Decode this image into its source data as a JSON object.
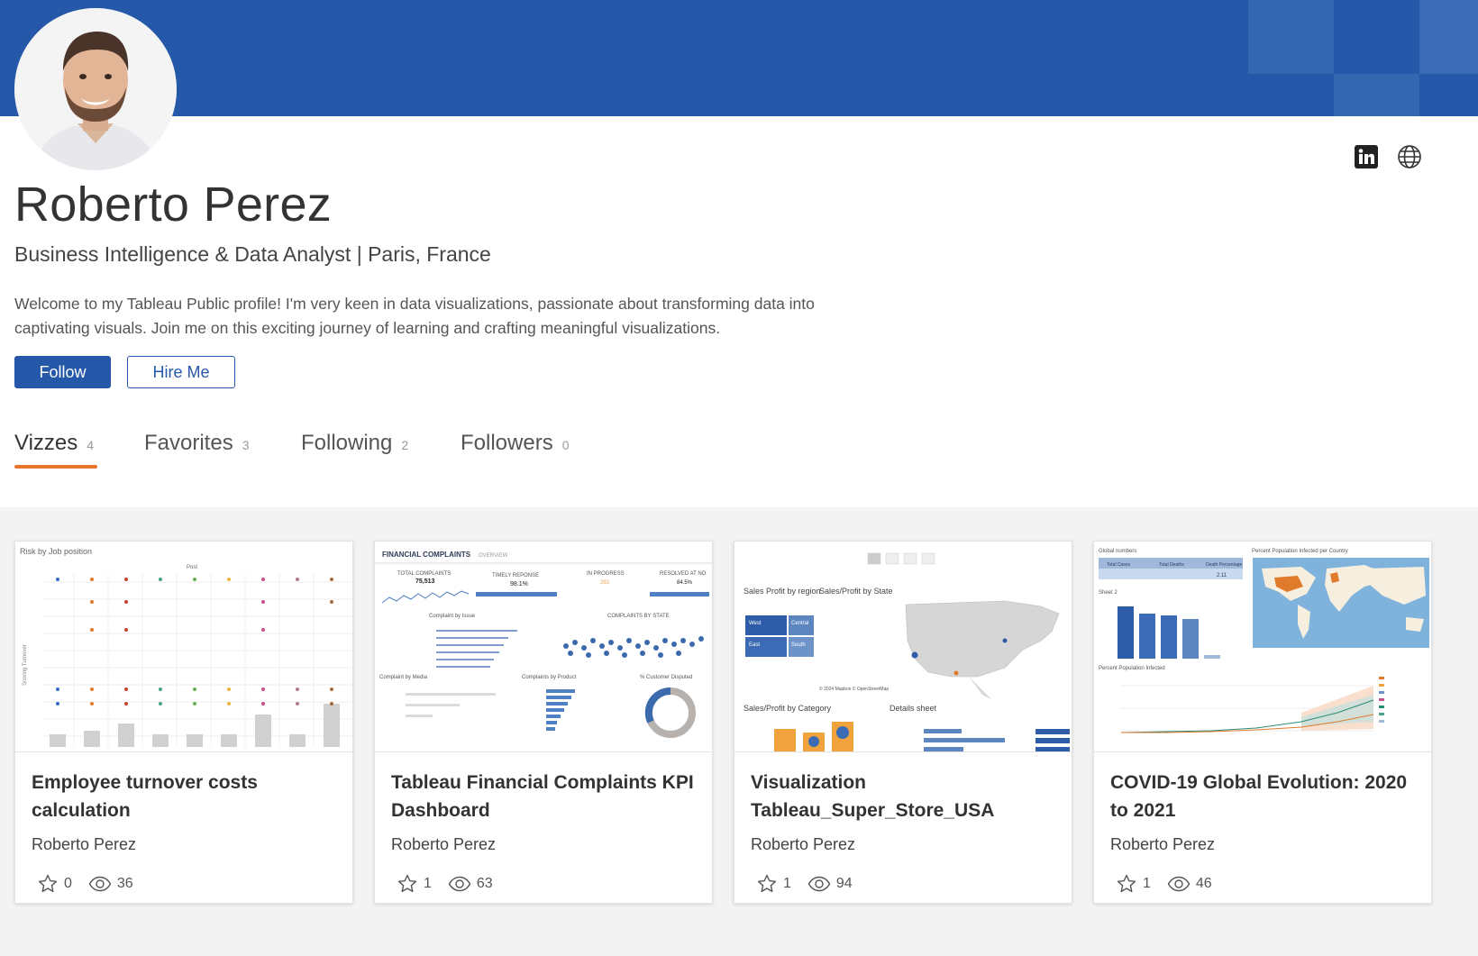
{
  "profile": {
    "name": "Roberto Perez",
    "headline": "Business Intelligence & Data Analyst | Paris, France",
    "bio": "Welcome to my Tableau Public profile! I'm very keen in data visualizations, passionate about transforming data into captivating visuals. Join me on this exciting journey of learning and crafting meaningful visualizations."
  },
  "buttons": {
    "follow": "Follow",
    "hire": "Hire Me"
  },
  "social": {
    "linkedin_icon": "linkedin-icon",
    "website_icon": "globe-icon"
  },
  "tabs": [
    {
      "label": "Vizzes",
      "count": "4"
    },
    {
      "label": "Favorites",
      "count": "3"
    },
    {
      "label": "Following",
      "count": "2"
    },
    {
      "label": "Followers",
      "count": "0"
    }
  ],
  "vizzes": [
    {
      "title": "Employee turnover costs calculation",
      "author": "Roberto Perez",
      "favorites": "0",
      "views": "36"
    },
    {
      "title": "Tableau Financial Complaints KPI Dashboard",
      "author": "Roberto Perez",
      "favorites": "1",
      "views": "63"
    },
    {
      "title": "Visualization Tableau_Super_Store_USA",
      "author": "Roberto Perez",
      "favorites": "1",
      "views": "94"
    },
    {
      "title": "COVID-19 Global Evolution: 2020 to 2021",
      "author": "Roberto Perez",
      "favorites": "1",
      "views": "46"
    }
  ],
  "thumbs": {
    "t1": {
      "title": "Risk by Job position",
      "header": "Post",
      "yaxis": "Scoring Turnover"
    },
    "t2": {
      "title": "FINANCIAL COMPLAINTS",
      "sub": "OVERVIEW",
      "k1": "TOTAL COMPLAINTS",
      "v1": "75,513",
      "k2": "TIMELY REPONSE",
      "v2": "98.1%",
      "k3": "IN PROGRESS",
      "v3": "283",
      "k4": "RESOLVED AT NO",
      "v4": "84.5%",
      "s1": "Complaint by Issue",
      "s2": "COMPLAINTS BY STATE",
      "s3": "Complaint by Media",
      "s4": "Complaints by Product",
      "s5": "% Customer Disputed"
    },
    "t3": {
      "s1": "Sales Profit by region",
      "s2": "Sales/Profit by State",
      "s3": "Sales/Profit by Category",
      "s4": "Details sheet",
      "r1": "West",
      "r2": "Central",
      "r3": "East",
      "r4": "South",
      "credit": "© 2024 Mapbox © OpenStreetMap"
    },
    "t4": {
      "s1": "Global numbers",
      "s2": "Percent Population Infected per Country",
      "s3": "Sheet 2",
      "s4": "Percent Population Infected",
      "h1": "Total Cases",
      "h2": "Total Deaths",
      "h3": "Death Percentage",
      "v3": "2.11"
    }
  },
  "colors": {
    "brand_blue": "#2558a8",
    "accent_orange": "#e8762d"
  }
}
